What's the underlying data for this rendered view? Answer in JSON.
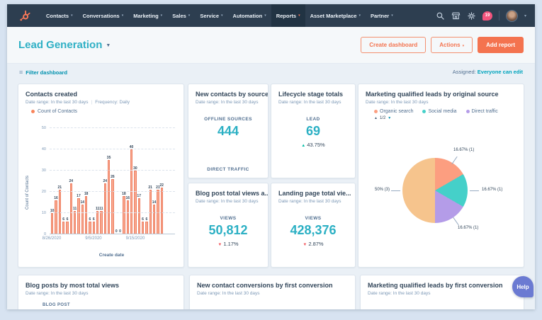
{
  "icons": {
    "caret_down_small": "▾",
    "caret_down": "▼",
    "hamburger": "≡",
    "arrow_up": "▲",
    "arrow_down": "▼"
  },
  "nav": {
    "items": [
      "Contacts",
      "Conversations",
      "Marketing",
      "Sales",
      "Service",
      "Automation",
      "Reports",
      "Asset Marketplace",
      "Partner"
    ],
    "active_index": 6,
    "notification_count": "19"
  },
  "header": {
    "title": "Lead Generation",
    "create_dashboard_label": "Create dashboard",
    "actions_label": "Actions",
    "add_report_label": "Add report"
  },
  "filter_bar": {
    "filter_label": "Filter dashboard",
    "assigned_label": "Assigned:",
    "assigned_value": "Everyone can edit"
  },
  "cards": {
    "contacts_created": {
      "title": "Contacts created",
      "date_range": "Date range: In the last 30 days",
      "frequency": "Frequency: Daily"
    },
    "new_contacts_by_source": {
      "title": "New contacts by source",
      "date_range": "Date range: In the last 30 days",
      "metric_label": "OFFLINE SOURCES",
      "metric_value": "444",
      "next_label": "DIRECT TRAFFIC"
    },
    "lifecycle_stage_totals": {
      "title": "Lifecycle stage totals",
      "date_range": "Date range: In the last 30 days",
      "metric_label": "LEAD",
      "metric_value": "69",
      "delta_arrow": "▲",
      "delta": "43.75%"
    },
    "blog_post_total_views": {
      "title": "Blog post total views a...",
      "date_range": "Date range: In the last 30 days",
      "metric_label": "VIEWS",
      "metric_value": "50,812",
      "delta_arrow": "▼",
      "delta": "1.17%"
    },
    "landing_page_total_views": {
      "title": "Landing page total vie...",
      "date_range": "Date range: In the last 30 days",
      "metric_label": "VIEWS",
      "metric_value": "428,376",
      "delta_arrow": "▼",
      "delta": "2.87%"
    },
    "mql_by_original_source": {
      "title": "Marketing qualified leads by original source",
      "date_range": "Date range: In the last 30 days"
    },
    "blog_posts_by_views": {
      "title": "Blog posts by most total views",
      "date_range": "Date range: In the last 30 days",
      "table_header": "BLOG POST"
    },
    "new_contact_conversions": {
      "title": "New contact conversions by first conversion",
      "date_range": "Date range: In the last 30 days"
    },
    "mql_by_first_conversion": {
      "title": "Marketing qualified leads by first conversion",
      "date_range": "Date range: In the last 30 days"
    }
  },
  "chart_data": [
    {
      "type": "bar",
      "title": "Contacts created",
      "xlabel": "Create date",
      "ylabel": "Count of Contacts",
      "ylim": [
        0,
        50
      ],
      "yticks": [
        0,
        10,
        20,
        30,
        40,
        50
      ],
      "grid": true,
      "series": [
        {
          "name": "Count of Contacts",
          "color": "#f8845b",
          "values": [
            10,
            16,
            21,
            6,
            6,
            24,
            11,
            17,
            14,
            18,
            6,
            6,
            11,
            11,
            24,
            35,
            26,
            0,
            0,
            18,
            16,
            40,
            30,
            17,
            6,
            6,
            21,
            14,
            21,
            22
          ]
        }
      ],
      "x_tick_labels": [
        {
          "index": 0,
          "label": "8/26/2020"
        },
        {
          "index": 10,
          "label": "9/5/2020"
        },
        {
          "index": 20,
          "label": "9/15/2020"
        }
      ]
    },
    {
      "type": "pie",
      "title": "Marketing qualified leads by original source",
      "legend_position": "top",
      "legend_pagination": "1/2",
      "slices": [
        {
          "legend": "Organic search",
          "color": "#fc9e80",
          "pct": 16.67,
          "count": 1,
          "label": "16.67% (1)"
        },
        {
          "legend": "Social media",
          "color": "#45d0c9",
          "pct": 16.67,
          "count": 1,
          "label": "16.67% (1)"
        },
        {
          "legend": "Direct traffic",
          "color": "#b49ce8",
          "pct": 16.67,
          "count": 1,
          "label": "16.67% (1)"
        },
        {
          "legend": "",
          "color": "#f6c48d",
          "pct": 50,
          "count": 3,
          "label": "50% (3)"
        }
      ]
    }
  ],
  "help_label": "Help",
  "colors": {
    "nav_bg": "#2d3e50",
    "accent_orange": "#ff7a59",
    "link_teal": "#0091ae",
    "metric_teal": "#2cb0c4",
    "delta_up_green": "#00bda5",
    "delta_down_red": "#f2545b",
    "page_bg": "#eaf0f6"
  }
}
